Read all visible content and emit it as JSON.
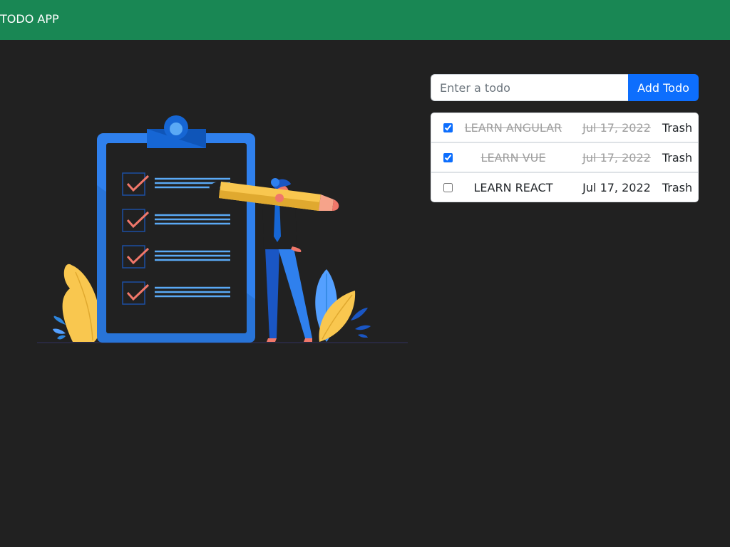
{
  "navbar": {
    "brand": "TODO APP",
    "bg_color": "#198754"
  },
  "form": {
    "placeholder": "Enter a todo",
    "value": "",
    "add_label": "Add Todo"
  },
  "todos": [
    {
      "text": "LEARN ANGULAR",
      "date": "Jul 17, 2022",
      "done": true,
      "trash_label": "Trash"
    },
    {
      "text": "LEARN VUE",
      "date": "Jul 17, 2022",
      "done": true,
      "trash_label": "Trash"
    },
    {
      "text": "LEARN REACT",
      "date": "Jul 17, 2022",
      "done": false,
      "trash_label": "Trash"
    }
  ],
  "illustration": {
    "icon": "checklist-clipboard-illustration"
  },
  "colors": {
    "page_bg": "#212121",
    "primary": "#0d6efd",
    "done_text": "#9e9e9e"
  }
}
